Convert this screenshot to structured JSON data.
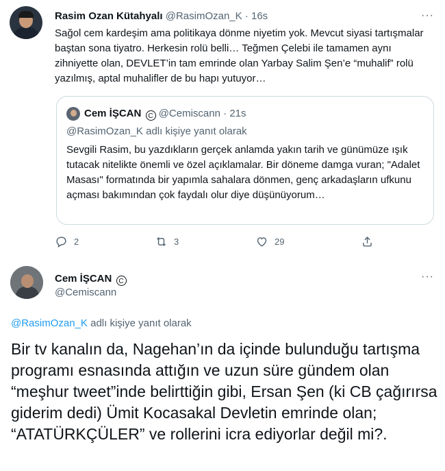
{
  "tweet": {
    "author_name": "Rasim Ozan Kütahyalı",
    "author_handle": "@RasimOzan_K",
    "time": "16s",
    "separator": "·",
    "more": "···",
    "text": "Sağol cem kardeşim ama politikaya dönme niyetim yok. Mevcut siyasi tartışmalar baştan sona tiyatro. Herkesin rolü belli… Teğmen Çelebi ile tamamen aynı zihniyette olan, DEVLET’in tam emrinde olan Yarbay Salim Şen’e “muhalif” rolü yazılmış, aptal muhalifler de bu hapı yutuyor…",
    "quoted": {
      "author_name": "Cem İŞCAN",
      "badge": "C",
      "author_handle": "@Cemiscann",
      "time": "21s",
      "reply_to_handle": "@RasimOzan_K",
      "reply_suffix": " adlı kişiye yanıt olarak",
      "text": "Sevgili Rasim, bu yazdıkların gerçek anlamda yakın tarih ve günümüze ışık tutacak nitelikte önemli ve özel açıklamalar. Bir döneme damga vuran; \"Adalet Masası\" formatında bir yapımla sahalara dönmen, genç arkadaşların ufkunu açması bakımından çok faydalı olur diye düşünüyorum…"
    },
    "actions": {
      "reply_count": "2",
      "retweet_count": "3",
      "like_count": "29"
    }
  },
  "reply_tweet": {
    "author_name": "Cem İŞCAN",
    "badge": "C",
    "author_handle": "@Cemiscann",
    "more": "···",
    "reply_to_handle": "@RasimOzan_K",
    "reply_suffix": " adlı kişiye yanıt olarak",
    "text": "Bir tv kanalın da, Nagehan’ın da içinde bulunduğu tartışma programı esnasında attığın ve uzun süre gündem olan “meşhur tweet”inde belirttiğin gibi, Ersan Şen (ki CB çağırırsa giderim dedi) Ümit Kocasakal Devletin emrinde olan; “ATATÜRKÇÜLER” ve rollerini icra ediyorlar değil mi?."
  },
  "colors": {
    "text": "#0f1419",
    "secondary": "#536471",
    "link": "#1d9bf0",
    "border": "#cfd9de"
  },
  "icons": [
    "reply-icon",
    "retweet-icon",
    "like-icon",
    "share-icon",
    "more-icon"
  ]
}
